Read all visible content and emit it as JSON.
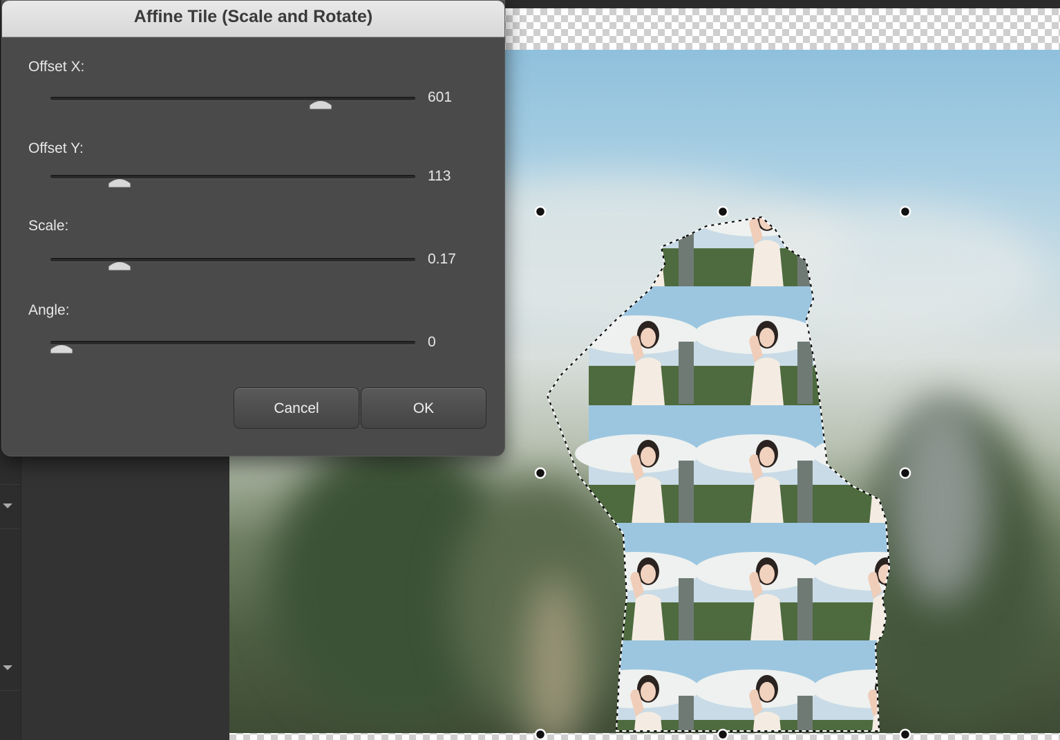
{
  "dialog": {
    "title": "Affine Tile (Scale and Rotate)",
    "fields": [
      {
        "label": "Offset X:",
        "value": "601",
        "slider_fraction": 0.74
      },
      {
        "label": "Offset Y:",
        "value": "113",
        "slider_fraction": 0.19
      },
      {
        "label": "Scale:",
        "value": "0.17",
        "slider_fraction": 0.19
      },
      {
        "label": "Angle:",
        "value": "0",
        "slider_fraction": 0.03
      }
    ],
    "cancel_label": "Cancel",
    "ok_label": "OK"
  },
  "colors": {
    "dialog_bg": "#4a4a4a",
    "titlebar_bg": "#dcdcdc",
    "panel_bg": "#333333"
  },
  "icons": [
    "disclosure-arrow-icon",
    "slider-thumb-icon",
    "transform-handle-icon"
  ]
}
